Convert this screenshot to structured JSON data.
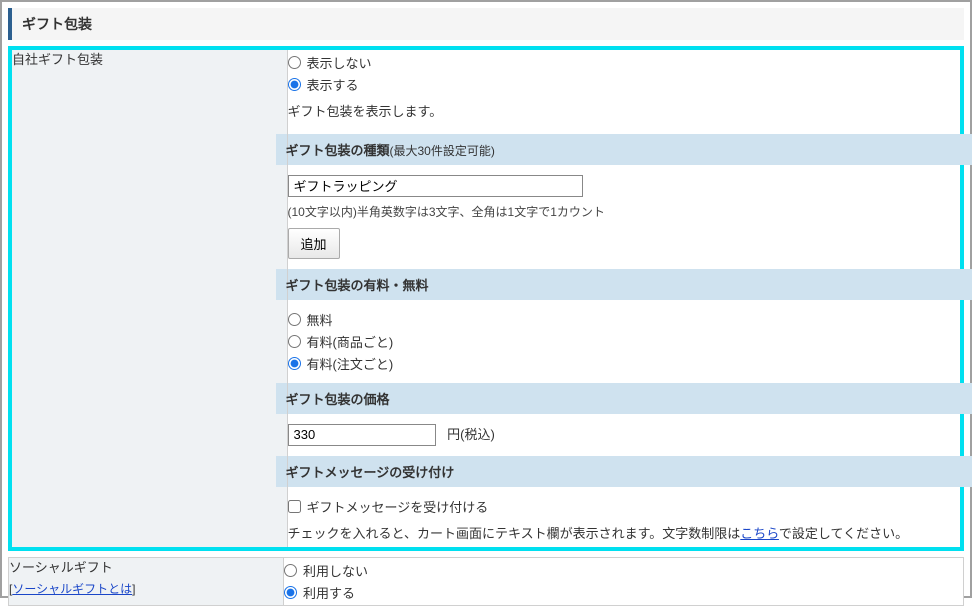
{
  "section_title": "ギフト包装",
  "row1": {
    "label": "自社ギフト包装",
    "display": {
      "hide": "表示しない",
      "show": "表示する"
    },
    "display_note": "ギフト包装を表示します。",
    "type_header": "ギフト包装の種類",
    "type_header_note": "(最大30件設定可能)",
    "type_input_value": "ギフトラッピング",
    "type_hint": "(10文字以内)半角英数字は3文字、全角は1文字で1カウント",
    "add_button": "追加",
    "fee_header": "ギフト包装の有料・無料",
    "fee_options": {
      "free": "無料",
      "per_item": "有料(商品ごと)",
      "per_order": "有料(注文ごと)"
    },
    "price_header": "ギフト包装の価格",
    "price_value": "330",
    "price_unit": "円(税込)",
    "msg_header": "ギフトメッセージの受け付け",
    "msg_check": "ギフトメッセージを受け付ける",
    "msg_note_prefix": "チェックを入れると、カート画面にテキスト欄が表示されます。文字数制限は",
    "msg_link": "こちら",
    "msg_note_suffix": "で設定してください。"
  },
  "row2": {
    "label": "ソーシャルギフト",
    "sublink_text": "ソーシャルギフトとは",
    "options": {
      "disable": "利用しない",
      "enable": "利用する"
    }
  }
}
